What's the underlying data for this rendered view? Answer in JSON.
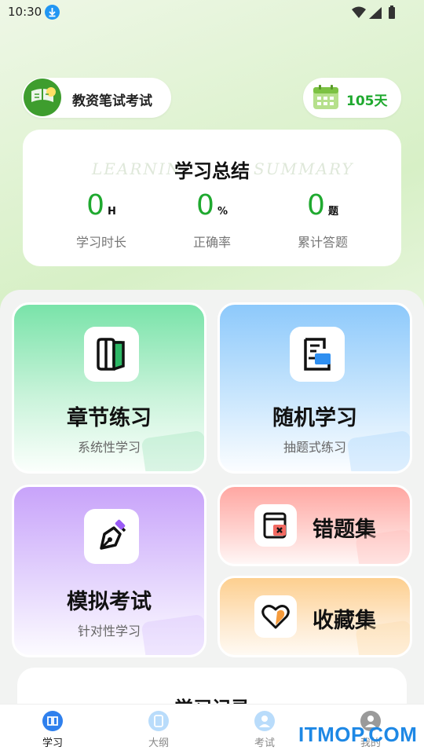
{
  "status_bar": {
    "time": "10:30"
  },
  "header": {
    "exam_name": "教资笔试考试",
    "days": "105天"
  },
  "summary": {
    "title": "学习总结",
    "deco_left": "LEARNIN",
    "deco_right": "SUMMARY",
    "stats": [
      {
        "value": "0",
        "unit": "H",
        "label": "学习时长"
      },
      {
        "value": "0",
        "unit": "%",
        "label": "正确率"
      },
      {
        "value": "0",
        "unit": "题",
        "label": "累计答题"
      }
    ]
  },
  "modules": {
    "chapter": {
      "title": "章节练习",
      "subtitle": "系统性学习"
    },
    "random": {
      "title": "随机学习",
      "subtitle": "抽题式练习"
    },
    "mock": {
      "title": "模拟考试",
      "subtitle": "针对性学习"
    },
    "wrong": {
      "title": "错题集"
    },
    "favorites": {
      "title": "收藏集"
    }
  },
  "record": {
    "title": "学习记录"
  },
  "tabs": [
    {
      "label": "学习",
      "active": true
    },
    {
      "label": "大纲",
      "active": false
    },
    {
      "label": "考试",
      "active": false
    },
    {
      "label": "我的",
      "active": false
    }
  ],
  "watermark": "ITMOP.COM",
  "colors": {
    "accent_green": "#1fa92f",
    "tab_active": "#2f80ed"
  }
}
